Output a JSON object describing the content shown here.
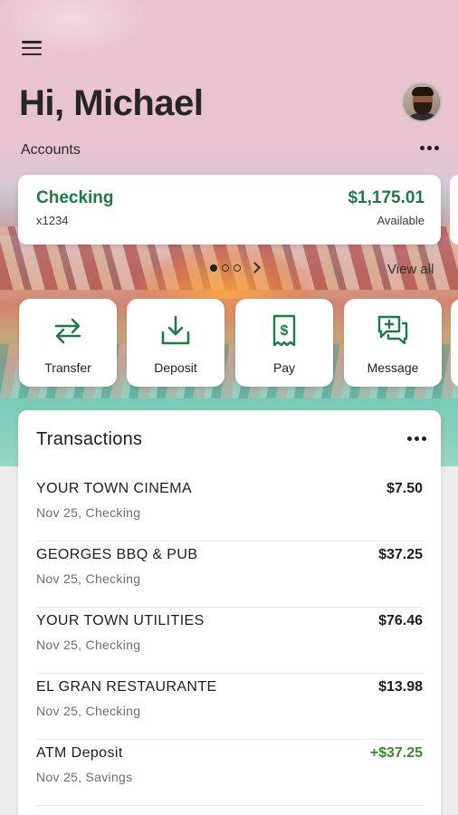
{
  "header": {
    "greeting": "Hi, Michael",
    "accounts_label": "Accounts"
  },
  "account": {
    "name": "Checking",
    "number": "x1234",
    "balance": "$1,175.01",
    "balance_label": "Available"
  },
  "carousel": {
    "view_all_label": "View all",
    "pages": 3,
    "current_page": 1
  },
  "actions": [
    {
      "label": "Transfer",
      "icon": "transfer-icon"
    },
    {
      "label": "Deposit",
      "icon": "deposit-icon"
    },
    {
      "label": "Pay",
      "icon": "pay-icon"
    },
    {
      "label": "Message",
      "icon": "message-icon"
    }
  ],
  "transactions": {
    "title": "Transactions",
    "items": [
      {
        "merchant": "YOUR TOWN CINEMA",
        "meta": "Nov 25, Checking",
        "amount": "$7.50"
      },
      {
        "merchant": "GEORGES BBQ & PUB",
        "meta": "Nov 25, Checking",
        "amount": "$37.25"
      },
      {
        "merchant": "YOUR TOWN UTILITIES",
        "meta": "Nov 25, Checking",
        "amount": "$76.46"
      },
      {
        "merchant": "EL GRAN RESTAURANTE",
        "meta": "Nov 25, Checking",
        "amount": "$13.98"
      },
      {
        "merchant": "ATM Deposit",
        "meta": "Nov 25, Savings",
        "amount": "+$37.25"
      }
    ]
  },
  "colors": {
    "accent_green": "#1e7a46",
    "positive_amount": "#3c8a2e"
  }
}
